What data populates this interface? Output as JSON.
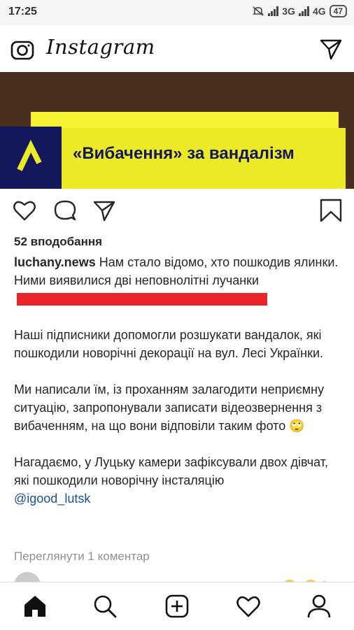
{
  "status_bar": {
    "time": "17:25",
    "network_1": "3G",
    "network_2": "4G",
    "battery": "47"
  },
  "app": {
    "title": "Instagram"
  },
  "post": {
    "image_headline": "«Вибачення» за вандалізм",
    "likes": "52 вподобання",
    "username": "luchany.news",
    "caption_p1": "Нам стало відомо, хто пошкодив ялинки. Ними виявилися дві неповнолітні лучанки",
    "caption_p2": "Наші підписники допомогли розшукати вандалок, які пошкодили новорічні декорації на вул. Лесі Українки.",
    "caption_p3": "Ми написали їм, із проханням залагодити неприємну ситуацію, запропонували записати відеозвернення з вибаченням, на що вони відповіли таким фото 🙄",
    "caption_p4": "Нагадаємо, у Луцьку камери зафіксували двох дівчат, які пошкодили новорічну інсталяцію",
    "mention": "@igood_lutsk",
    "view_comments": "Переглянути 1 коментар"
  },
  "colors": {
    "accent_yellow": "#ecea27",
    "navy": "#13175c",
    "brown": "#4a2e1f",
    "redaction": "#e8232a",
    "link": "#1a4fa0"
  },
  "icons": {
    "top_left": "camera-icon",
    "top_right": "direct-send-icon",
    "actions": [
      "heart-icon",
      "comment-icon",
      "share-icon",
      "bookmark-icon"
    ],
    "nav": [
      "home-icon",
      "search-icon",
      "add-post-icon",
      "activity-heart-icon",
      "profile-icon"
    ]
  }
}
